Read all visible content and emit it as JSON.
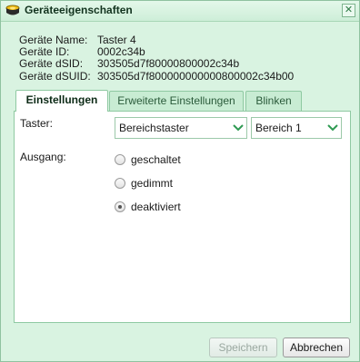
{
  "window": {
    "title": "Geräteeigenschaften",
    "title_icon": "device-properties-icon",
    "close_glyph": "✕"
  },
  "device_info": [
    {
      "key": "Geräte Name:",
      "value": "Taster 4"
    },
    {
      "key": "Geräte ID:",
      "value": "0002c34b"
    },
    {
      "key": "Geräte dSID:",
      "value": "303505d7f80000800002c34b"
    },
    {
      "key": "Geräte dSUID:",
      "value": "303505d7f800000000000800002c34b00"
    }
  ],
  "tabs": [
    {
      "label": "Einstellungen",
      "active": true
    },
    {
      "label": "Erweiterte Einstellungen",
      "active": false
    },
    {
      "label": "Blinken",
      "active": false
    }
  ],
  "settings": {
    "taster_label": "Taster:",
    "taster_mode_select": "Bereichstaster",
    "taster_area_select": "Bereich 1",
    "ausgang_label": "Ausgang:",
    "ausgang_options": [
      {
        "label": "geschaltet",
        "selected": false
      },
      {
        "label": "gedimmt",
        "selected": false
      },
      {
        "label": "deaktiviert",
        "selected": true
      }
    ]
  },
  "buttons": {
    "save": "Speichern",
    "cancel": "Abbrechen"
  },
  "colors": {
    "window_bg": "#d9f3e1",
    "accent": "#2e9a52"
  }
}
